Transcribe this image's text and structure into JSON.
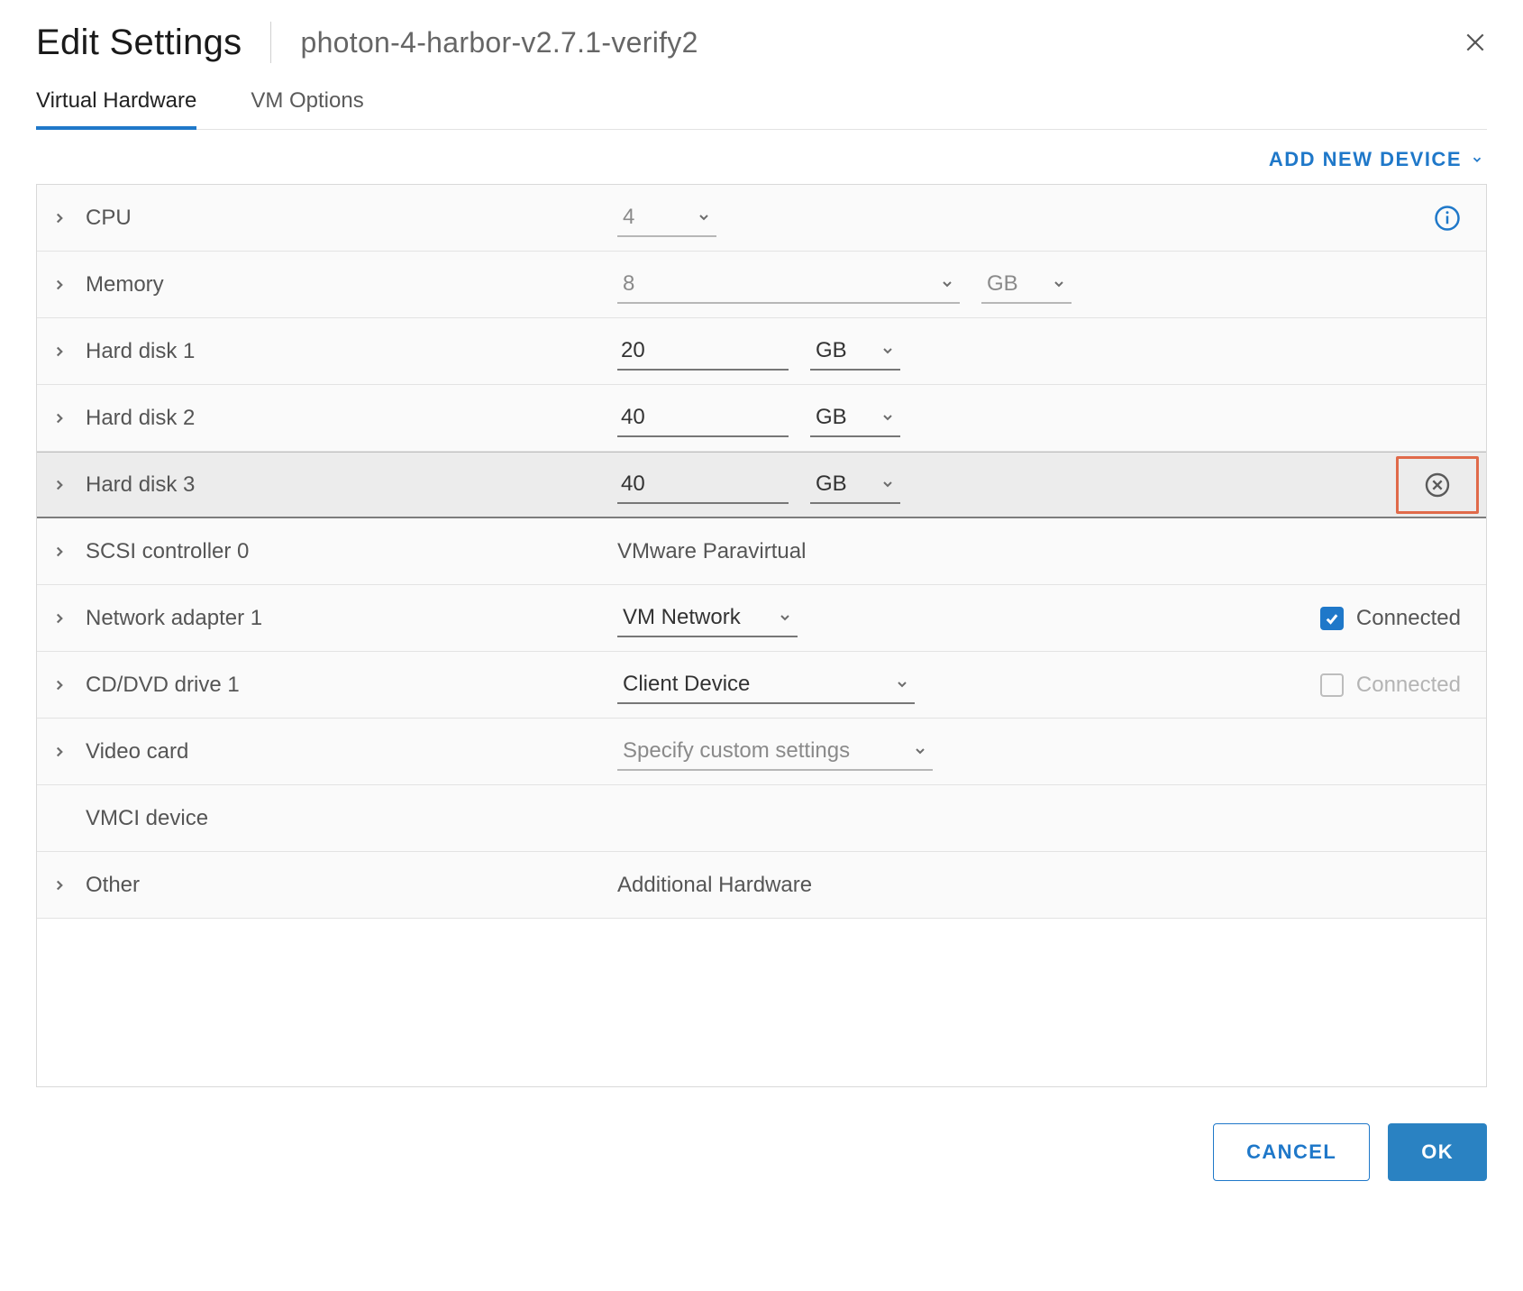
{
  "header": {
    "title": "Edit Settings",
    "vm_name": "photon-4-harbor-v2.7.1-verify2"
  },
  "tabs": {
    "virtual_hardware": "Virtual Hardware",
    "vm_options": "VM Options"
  },
  "add_device_label": "ADD NEW DEVICE",
  "rows": {
    "cpu": {
      "label": "CPU",
      "value": "4"
    },
    "memory": {
      "label": "Memory",
      "value": "8",
      "unit": "GB"
    },
    "hdd1": {
      "label": "Hard disk 1",
      "value": "20",
      "unit": "GB"
    },
    "hdd2": {
      "label": "Hard disk 2",
      "value": "40",
      "unit": "GB"
    },
    "hdd3": {
      "label": "Hard disk 3",
      "value": "40",
      "unit": "GB"
    },
    "scsi0": {
      "label": "SCSI controller 0",
      "value": "VMware Paravirtual"
    },
    "net1": {
      "label": "Network adapter 1",
      "value": "VM Network",
      "connected_label": "Connected"
    },
    "cd1": {
      "label": "CD/DVD drive 1",
      "value": "Client Device",
      "connected_label": "Connected"
    },
    "video": {
      "label": "Video card",
      "value": "Specify custom settings"
    },
    "vmci": {
      "label": "VMCI device"
    },
    "other": {
      "label": "Other",
      "value": "Additional Hardware"
    }
  },
  "footer": {
    "cancel": "CANCEL",
    "ok": "OK"
  }
}
